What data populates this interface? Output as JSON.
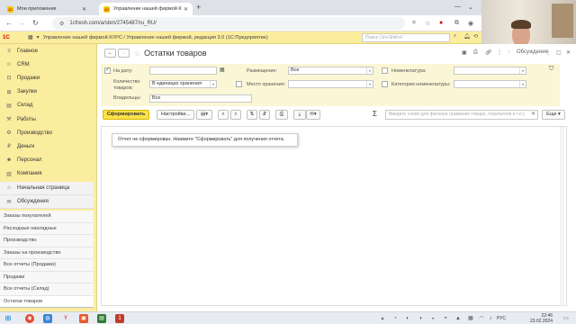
{
  "browser": {
    "tabs": [
      {
        "title": "Мои приложения",
        "favicon": "1c-favicon"
      },
      {
        "title": "Управление нашей фирмой К",
        "favicon": "1c-favicon"
      }
    ],
    "new_tab_glyph": "+",
    "url": "1cfresh.com/a/sbm/2745487/ru_RU/"
  },
  "app": {
    "logo": "1С",
    "title": "Управление нашей фирмой КУРС / Управление нашей фирмой, редакция 3.0  (1С:Предприятие)",
    "search_placeholder": "Поиск Ctrl+Shift+F"
  },
  "sidebar": {
    "items": [
      {
        "label": "Главное",
        "icon": "menu-icon"
      },
      {
        "label": "CRM",
        "icon": "crm-icon"
      },
      {
        "label": "Продажи",
        "icon": "sales-icon"
      },
      {
        "label": "Закупки",
        "icon": "purchases-icon"
      },
      {
        "label": "Склад",
        "icon": "warehouse-icon"
      },
      {
        "label": "Работы",
        "icon": "works-icon"
      },
      {
        "label": "Производство",
        "icon": "production-icon"
      },
      {
        "label": "Деньги",
        "icon": "money-icon"
      },
      {
        "label": "Персонал",
        "icon": "staff-icon"
      },
      {
        "label": "Компания",
        "icon": "company-icon"
      }
    ],
    "home": "Начальная страница",
    "discussions": "Обсуждения",
    "open_windows": [
      "Заказы покупателей",
      "Расходные накладные",
      "Производство",
      "Заказы на производство",
      "Все отчеты (Продажи)",
      "Продажи",
      "Все отчеты (Склад)",
      "Остатки товаров"
    ]
  },
  "form": {
    "title": "Остатки товаров",
    "discussion_label": "Обсуждение",
    "filters": {
      "date_label": "На дату:",
      "date_value": "",
      "qty_label": "Количество товаров:",
      "qty_value": "В единицах хранения",
      "owners_label": "Владельцы:",
      "owners_value": "Все",
      "placement_label": "Размещение:",
      "placement_value": "Все",
      "storage_label": "Место хранения:",
      "storage_value": "",
      "nomenclature_label": "Номенклатура:",
      "nomenclature_value": "",
      "category_label": "Категория номенклатуры:",
      "category_value": ""
    },
    "toolbar": {
      "generate": "Сформировать",
      "settings": "Настройки...",
      "search_placeholder": "Введите слово для фильтра (название товара, покупателя и т.п.)",
      "more": "Еще"
    },
    "message": "Отчет не сформирован. Нажмите \"Сформировать\" для получения отчета."
  },
  "taskbar": {
    "lang": "РУС",
    "time": "22:46",
    "date": "23.02.2024"
  }
}
